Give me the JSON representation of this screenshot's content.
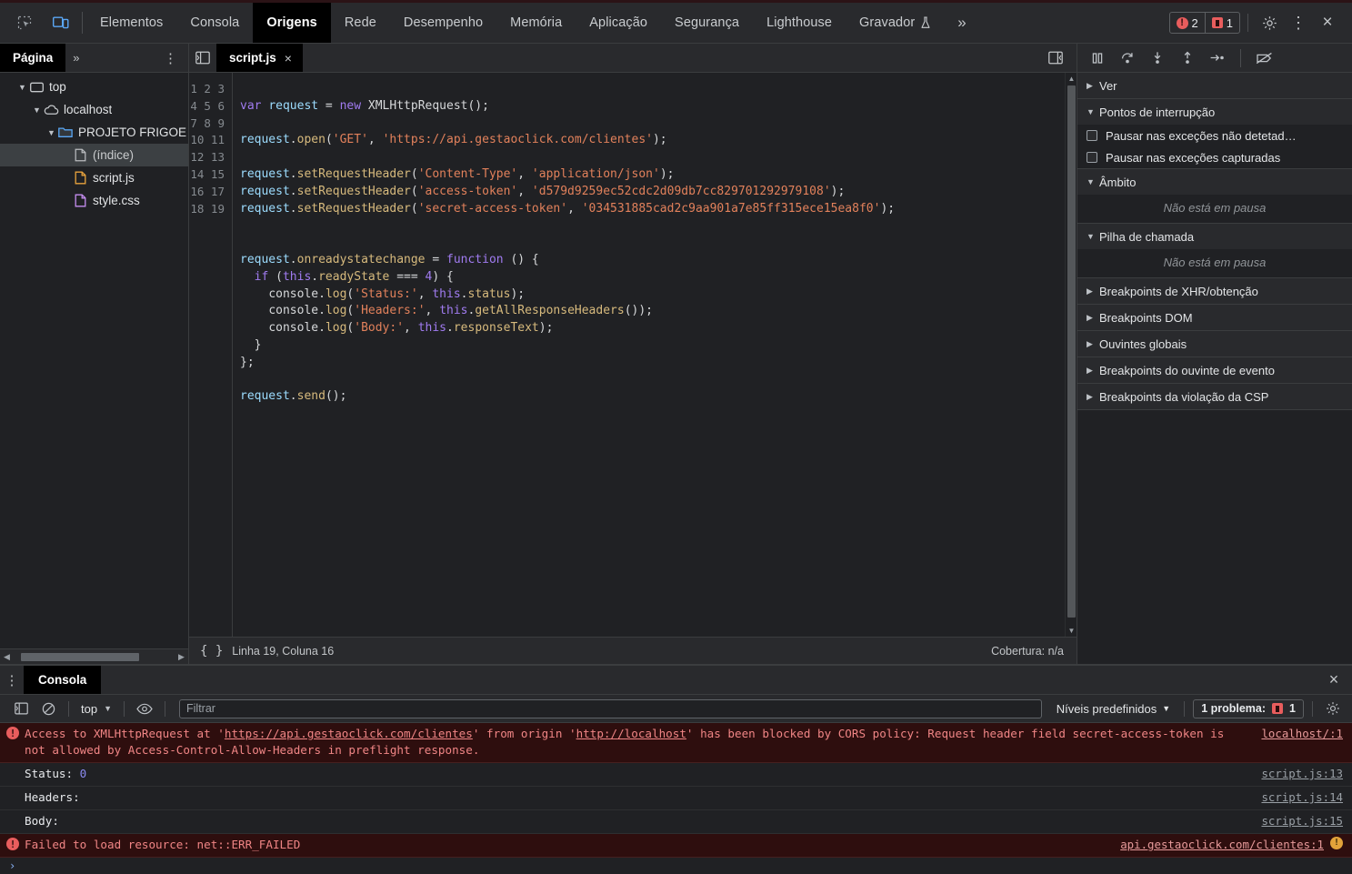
{
  "toolbar": {
    "icons": [
      {
        "name": "inspect-element-icon"
      },
      {
        "name": "device-toolbar-icon"
      }
    ],
    "tabs": [
      {
        "label": "Elementos",
        "active": false
      },
      {
        "label": "Consola",
        "active": false
      },
      {
        "label": "Origens",
        "active": true
      },
      {
        "label": "Rede",
        "active": false
      },
      {
        "label": "Desempenho",
        "active": false
      },
      {
        "label": "Memória",
        "active": false
      },
      {
        "label": "Aplicação",
        "active": false
      },
      {
        "label": "Segurança",
        "active": false
      },
      {
        "label": "Lighthouse",
        "active": false
      },
      {
        "label": "Gravador",
        "active": false
      }
    ],
    "more_tabs": "»",
    "error_count": "2",
    "warning_count": "1",
    "settings_label": "gear-icon",
    "kebab_label": "kebab-icon",
    "close_label": "×"
  },
  "navigator": {
    "tab_label": "Página",
    "more_label": "»",
    "kebab": "⋮",
    "tree": [
      {
        "label": "top",
        "icon": "frame-icon",
        "depth": 0,
        "expanded": true,
        "selected": false
      },
      {
        "label": "localhost",
        "icon": "cloud-icon",
        "depth": 1,
        "expanded": true,
        "selected": false
      },
      {
        "label": "PROJETO FRIGOE",
        "icon": "folder-icon",
        "depth": 2,
        "expanded": true,
        "selected": false
      },
      {
        "label": "(índice)",
        "icon": "doc-icon",
        "depth": 3,
        "expanded": null,
        "selected": true
      },
      {
        "label": "script.js",
        "icon": "js-icon",
        "depth": 3,
        "expanded": null,
        "selected": false
      },
      {
        "label": "style.css",
        "icon": "css-icon",
        "depth": 3,
        "expanded": null,
        "selected": false
      }
    ]
  },
  "editor": {
    "tab_label": "script.js",
    "tab_close": "×",
    "status_line": "Linha 19, Coluna 16",
    "status_coverage": "Cobertura: n/a",
    "format_icon": "{ }",
    "lines": [
      {
        "n": 1,
        "text": ""
      },
      {
        "n": 2,
        "text": "var request = new XMLHttpRequest();"
      },
      {
        "n": 3,
        "text": ""
      },
      {
        "n": 4,
        "text": "request.open('GET', 'https://api.gestaoclick.com/clientes');"
      },
      {
        "n": 5,
        "text": ""
      },
      {
        "n": 6,
        "text": "request.setRequestHeader('Content-Type', 'application/json');"
      },
      {
        "n": 7,
        "text": "request.setRequestHeader('access-token', 'd579d9259ec52cdc2d09db7cc829701292979108');"
      },
      {
        "n": 8,
        "text": "request.setRequestHeader('secret-access-token', '034531885cad2c9aa901a7e85ff315ece15ea8f0');"
      },
      {
        "n": 9,
        "text": ""
      },
      {
        "n": 10,
        "text": ""
      },
      {
        "n": 11,
        "text": "request.onreadystatechange = function () {"
      },
      {
        "n": 12,
        "text": "  if (this.readyState === 4) {"
      },
      {
        "n": 13,
        "text": "    console.log('Status:', this.status);"
      },
      {
        "n": 14,
        "text": "    console.log('Headers:', this.getAllResponseHeaders());"
      },
      {
        "n": 15,
        "text": "    console.log('Body:', this.responseText);"
      },
      {
        "n": 16,
        "text": "  }"
      },
      {
        "n": 17,
        "text": "};"
      },
      {
        "n": 18,
        "text": ""
      },
      {
        "n": 19,
        "text": "request.send();"
      }
    ]
  },
  "debugger": {
    "controls": [
      {
        "name": "resume-pause-button"
      },
      {
        "name": "step-over-button"
      },
      {
        "name": "step-into-button"
      },
      {
        "name": "step-out-button"
      },
      {
        "name": "step-button"
      },
      {
        "name": "deactivate-breakpoints-button"
      }
    ],
    "sections": [
      {
        "title": "Ver",
        "expanded": false,
        "type": "empty"
      },
      {
        "title": "Pontos de interrupção",
        "expanded": true,
        "type": "checkboxes",
        "items": [
          {
            "label": "Pausar nas exceções não detetad…",
            "checked": false
          },
          {
            "label": "Pausar nas exceções capturadas",
            "checked": false
          }
        ]
      },
      {
        "title": "Âmbito",
        "expanded": true,
        "type": "note",
        "note": "Não está em pausa"
      },
      {
        "title": "Pilha de chamada",
        "expanded": true,
        "type": "note",
        "note": "Não está em pausa"
      },
      {
        "title": "Breakpoints de XHR/obtenção",
        "expanded": false,
        "type": "empty"
      },
      {
        "title": "Breakpoints DOM",
        "expanded": false,
        "type": "empty"
      },
      {
        "title": "Ouvintes globais",
        "expanded": false,
        "type": "empty"
      },
      {
        "title": "Breakpoints do ouvinte de evento",
        "expanded": false,
        "type": "empty"
      },
      {
        "title": "Breakpoints da violação da CSP",
        "expanded": false,
        "type": "empty"
      }
    ]
  },
  "drawer": {
    "kebab": "⋮",
    "tab_label": "Consola",
    "close": "×",
    "filter_placeholder": "Filtrar",
    "filter_value": "",
    "context": "top",
    "levels_label": "Níveis predefinidos",
    "problems_label": "1 problema:",
    "problems_count": "1",
    "settings_icon": "gear-icon",
    "messages": [
      {
        "type": "error",
        "parts": [
          {
            "t": "Access to XMLHttpRequest at '",
            "link": false
          },
          {
            "t": "https://api.gestaoclick.com/clientes",
            "link": true
          },
          {
            "t": "' from origin '",
            "link": false
          },
          {
            "t": "http://localhost",
            "link": true
          },
          {
            "t": "' has been blocked by CORS policy: Request header field secret-access-token is not allowed by Access-Control-Allow-Headers in preflight response.",
            "link": false
          }
        ],
        "source": "localhost/:1"
      },
      {
        "type": "log",
        "label": "Status:",
        "value": "0",
        "value_kind": "number",
        "source": "script.js:13"
      },
      {
        "type": "log",
        "label": "Headers:",
        "value": "",
        "value_kind": "none",
        "source": "script.js:14"
      },
      {
        "type": "log",
        "label": "Body:",
        "value": "",
        "value_kind": "none",
        "source": "script.js:15"
      },
      {
        "type": "error",
        "parts": [
          {
            "t": "Failed to load resource: net::ERR_FAILED",
            "link": false
          }
        ],
        "source": "api.gestaoclick.com/clientes:1",
        "has_warn_ball": true
      }
    ],
    "prompt_caret": "›"
  },
  "colors": {
    "accent_blue": "#5aa7f5",
    "error_red": "#e85d5d",
    "error_bg": "#2e0e0e",
    "panel_bg": "#292a2d",
    "body_bg": "#202124"
  }
}
